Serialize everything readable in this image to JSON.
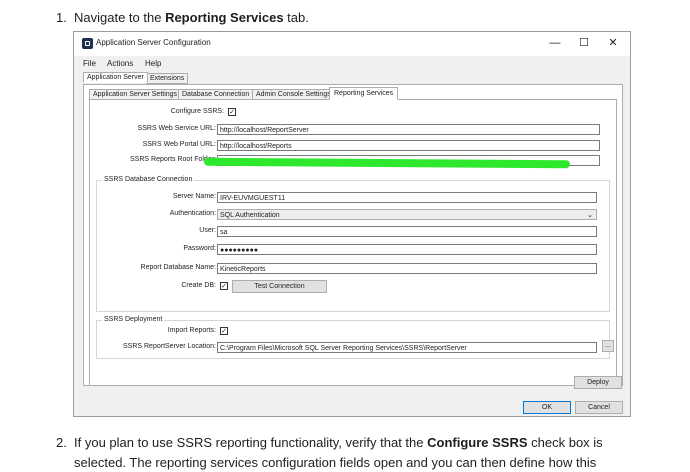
{
  "steps": [
    {
      "num": "1.",
      "before": "Navigate to the ",
      "bold": "Reporting Services",
      "after": " tab."
    },
    {
      "num": "2.",
      "before": "If you plan to use SSRS reporting functionality, verify that the ",
      "bold": "Configure SSRS",
      "after": " check box is"
    },
    {
      "line2": "selected. The reporting services configuration fields open and you can then define how this"
    }
  ],
  "window": {
    "title": "Application Server Configuration",
    "minimize": "—",
    "maximize": "☐",
    "close": "✕",
    "menu": [
      "File",
      "Actions",
      "Help"
    ],
    "outer_tabs": [
      "Application Server",
      "Extensions"
    ],
    "inner_tabs": [
      "Application Server Settings",
      "Database Connection",
      "Admin Console Settings",
      "Reporting Services"
    ]
  },
  "ssrs": {
    "configure_label": "Configure SSRS:",
    "configure_checked": true,
    "web_service_label": "SSRS Web Service URL:",
    "web_service_value": "http://localhost/ReportServer",
    "web_portal_label": "SSRS Web Portal URL:",
    "web_portal_value": "http://localhost/Reports",
    "root_folder_label": "SSRS Reports Root Folder:",
    "root_folder_value": ""
  },
  "db": {
    "group_label": "SSRS Database Connection",
    "server_label": "Server Name:",
    "server_value": "IRV-EUVMGUEST11",
    "auth_label": "Authentication:",
    "auth_value": "SQL Authentication",
    "user_label": "User:",
    "user_value": "sa",
    "password_label": "Password:",
    "password_value": "●●●●●●●●●",
    "report_db_label": "Report Database Name:",
    "report_db_value": "KineticReports",
    "create_db_label": "Create DB:",
    "create_db_checked": true,
    "test_button": "Test Connection"
  },
  "deploy": {
    "group_label": "SSRS Deployment",
    "import_label": "Import Reports:",
    "import_checked": true,
    "location_label": "SSRS ReportServer Location:",
    "location_value": "C:\\Program Files\\Microsoft SQL Server Reporting Services\\SSRS\\ReportServer",
    "browse": "..."
  },
  "buttons": {
    "deploy": "Deploy",
    "ok": "OK",
    "cancel": "Cancel"
  },
  "check_glyph": "✓"
}
